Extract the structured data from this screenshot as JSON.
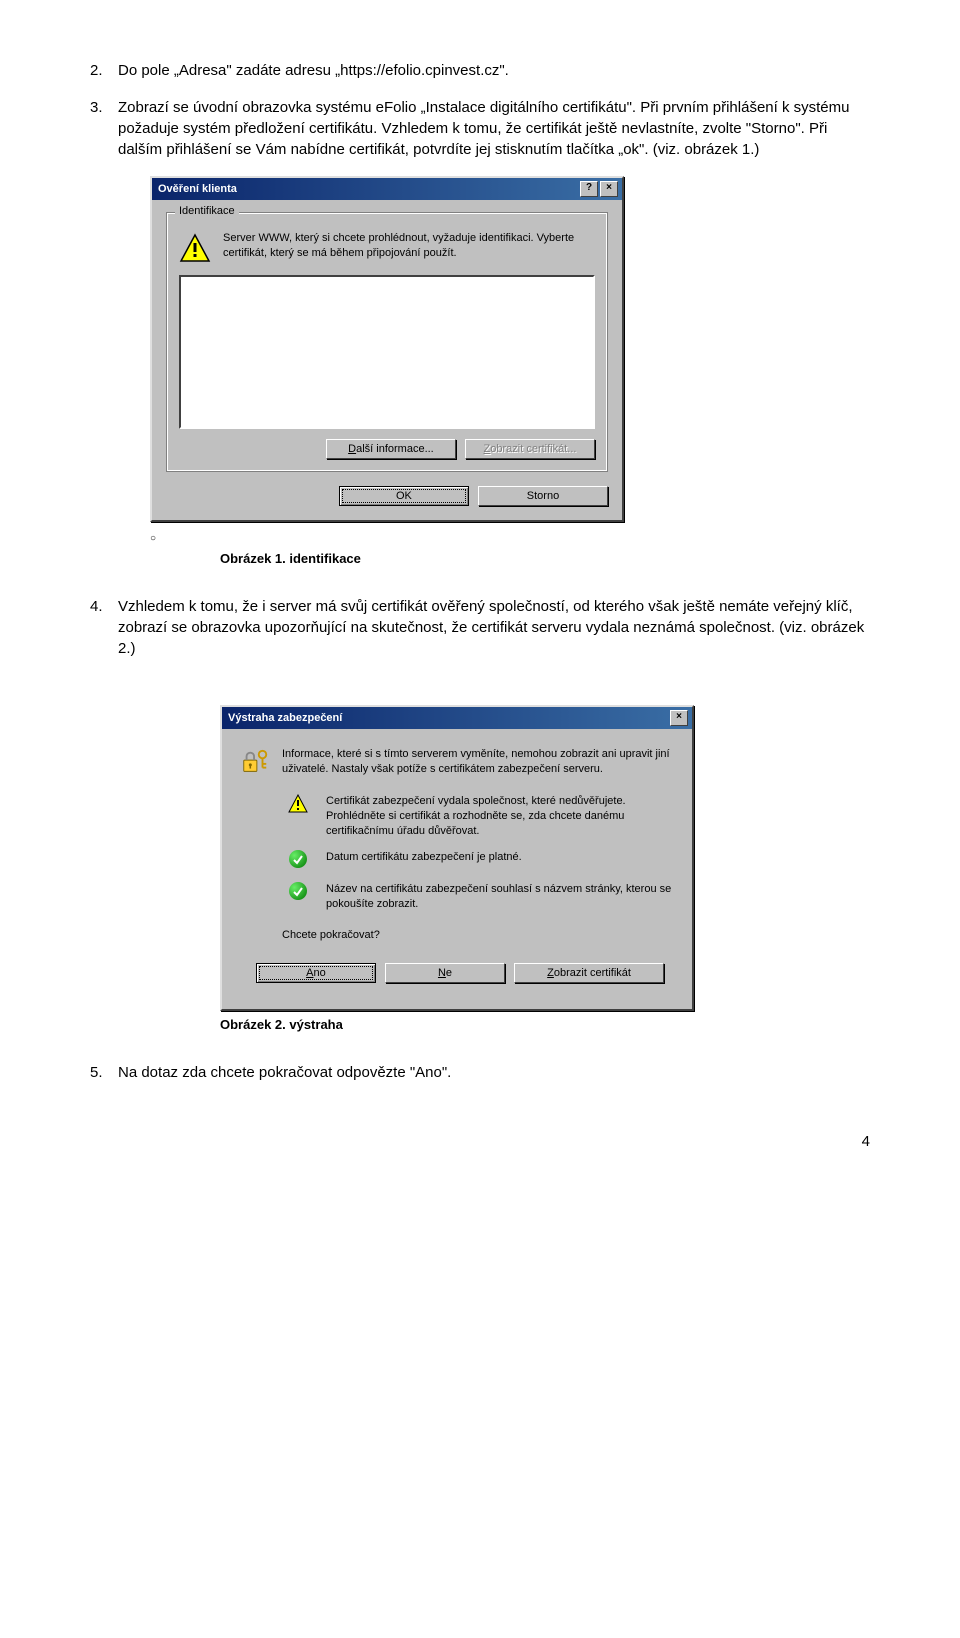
{
  "items": {
    "n2": {
      "num": "2.",
      "text": "Do pole „Adresa\" zadáte adresu „https://efolio.cpinvest.cz\"."
    },
    "n3": {
      "num": "3.",
      "text": "Zobrazí se úvodní obrazovka systému eFolio „Instalace digitálního certifikátu\". Při prvním přihlášení k systému požaduje systém předložení certifikátu. Vzhledem k tomu, že certifikát ještě nevlastníte, zvolte \"Storno\". Při dalším přihlášení se Vám nabídne certifikát, potvrdíte jej stisknutím tlačítka „ok\". (viz. obrázek 1.)"
    },
    "n4": {
      "num": "4.",
      "text": "Vzhledem k tomu, že i server má svůj certifikát ověřený společností, od kterého však ještě nemáte veřejný klíč, zobrazí se obrazovka upozorňující na skutečnost, že certifikát serveru vydala neznámá společnost. (viz. obrázek 2.)"
    },
    "n5": {
      "num": "5.",
      "text": "Na dotaz zda chcete pokračovat odpovězte \"Ano\"."
    }
  },
  "caption1": "Obrázek 1. identifikace",
  "caption2": "Obrázek 2. výstraha",
  "dlg1": {
    "title": "Ověření klienta",
    "group": "Identifikace",
    "msg": "Server WWW, který si chcete prohlédnout, vyžaduje identifikaci. Vyberte certifikát, který se má během připojování použít.",
    "more": "alší informace...",
    "more_u": "D",
    "showcert": "obrazit certifikát...",
    "showcert_u": "Z",
    "ok": "OK",
    "cancel": "Storno"
  },
  "dlg2": {
    "title": "Výstraha zabezpečení",
    "line1": "Informace, které si s tímto serverem vyměníte, nemohou zobrazit ani upravit jiní uživatelé. Nastaly však potíže s certifikátem zabezpečení serveru.",
    "line2": "Certifikát zabezpečení vydala společnost, které nedůvěřujete. Prohlédněte si certifikát a rozhodněte se, zda chcete danému certifikačnímu úřadu důvěřovat.",
    "line3": "Datum certifikátu zabezpečení je platné.",
    "line4": "Název na certifikátu zabezpečení souhlasí s názvem stránky, kterou se pokoušíte zobrazit.",
    "prompt": "Chcete pokračovat?",
    "yes": "no",
    "yes_u": "A",
    "no": "e",
    "no_u": "N",
    "show": "obrazit certifikát",
    "show_u": "Z"
  },
  "pagenum": "4"
}
